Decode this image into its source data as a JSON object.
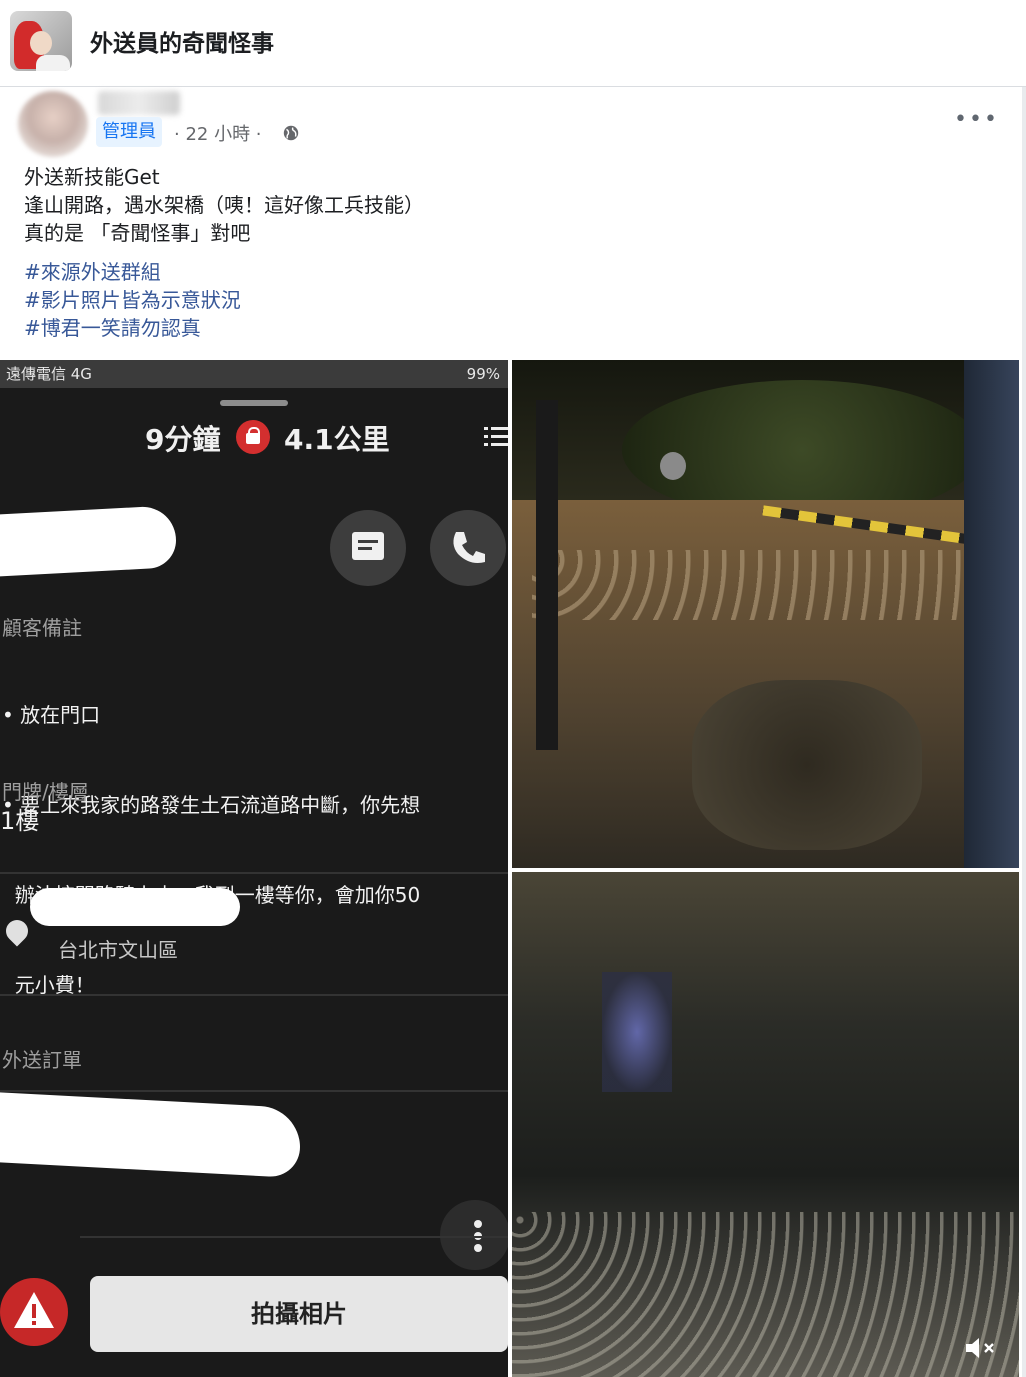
{
  "group": {
    "name": "外送員的奇聞怪事"
  },
  "post": {
    "author_role": "管理員",
    "time": "· 22 小時 ·",
    "body_lines": [
      "外送新技能Get",
      "逢山開路，遇水架橋（咦！這好像工兵技能）",
      "真的是 「奇聞怪事」對吧"
    ],
    "hashtags": [
      "#來源外送群組",
      "#影片照片皆為示意狀況",
      "#博君一笑請勿認真"
    ]
  },
  "screenshot": {
    "carrier": "遠傳電信  4G",
    "battery": "99%",
    "eta": "9分鐘",
    "distance": "4.1公里",
    "note_label": "顧客備註",
    "notes": [
      "• 放在門口",
      "• 要上來我家的路發生土石流道路中斷，你先想",
      "  辦法挖開路騎上來，我到一樓等你，會加你50",
      "  元小費！"
    ],
    "floor_label": "門牌/樓層",
    "floor_value": "1樓",
    "district": "台北市文山區",
    "order_label": "外送訂單",
    "photo_button": "拍攝相片"
  },
  "icons": [
    "globe-icon",
    "more-options-icon",
    "message-icon",
    "phone-icon",
    "lock-icon",
    "menu-icon",
    "location-pin-icon",
    "warning-icon",
    "kebab-menu-icon",
    "mute-icon"
  ]
}
